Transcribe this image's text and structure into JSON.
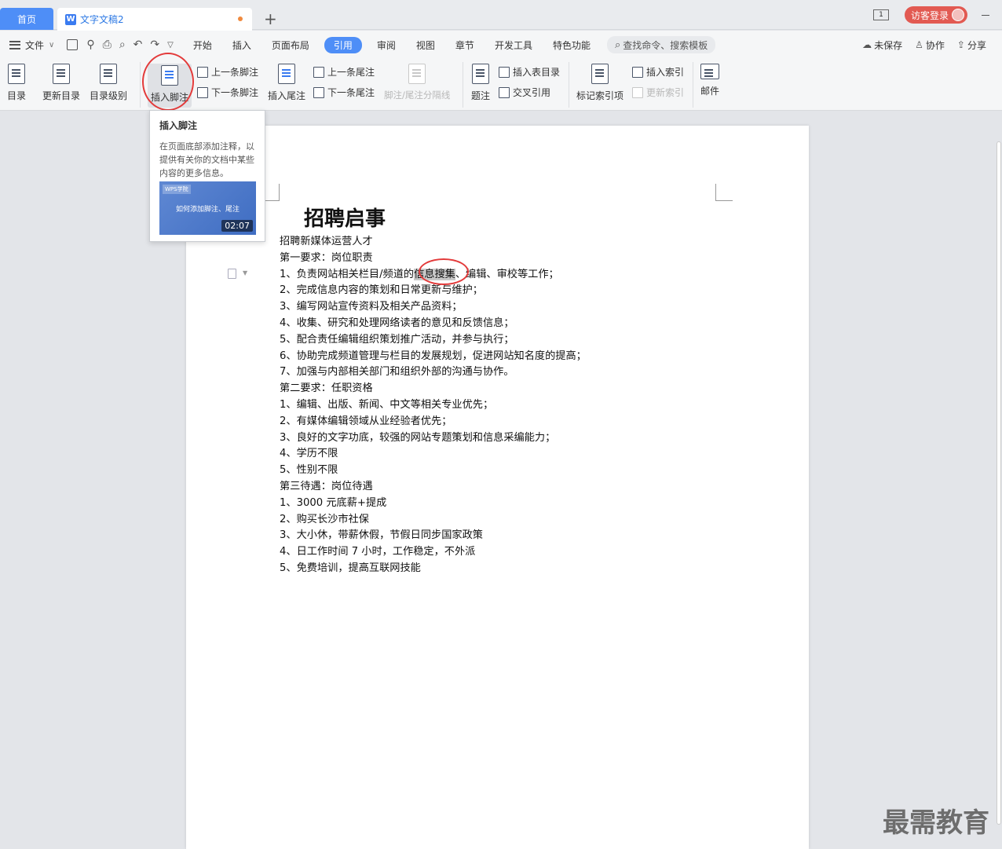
{
  "tabs": {
    "home": "首页",
    "document": "文字文稿2",
    "new": "+"
  },
  "titlebar": {
    "page_count": "1",
    "login": "访客登录"
  },
  "menu": {
    "file": "文件",
    "tabs": [
      "开始",
      "插入",
      "页面布局",
      "引用",
      "审阅",
      "视图",
      "章节",
      "开发工具",
      "特色功能"
    ],
    "active_tab": "引用",
    "search_placeholder": "查找命令、搜索模板",
    "unsaved": "未保存",
    "collaborate": "协作",
    "share": "分享"
  },
  "ribbon": {
    "toc": "目录",
    "update_toc": "更新目录",
    "toc_level": "目录级别",
    "insert_footnote": "插入脚注",
    "prev_footnote": "上一条脚注",
    "next_footnote": "下一条脚注",
    "insert_endnote": "插入尾注",
    "prev_endnote": "上一条尾注",
    "next_endnote": "下一条尾注",
    "separator_line": "脚注/尾注分隔线",
    "caption": "题注",
    "insert_table_of_figures": "插入表目录",
    "cross_reference": "交叉引用",
    "mark_index": "标记索引项",
    "insert_index": "插入索引",
    "update_index": "更新索引",
    "mail": "邮件"
  },
  "tooltip": {
    "title": "插入脚注",
    "description": "在页面底部添加注释，以提供有关你的文档中某些内容的更多信息。",
    "video_logo": "WPS学院",
    "video_title": "如何添加脚注、尾注",
    "video_duration": "02:07"
  },
  "document": {
    "title": "招聘启事",
    "line1_pre": "1、负责网站相关栏目/频道的",
    "line1_sel": "信息搜集",
    "line1_post": "、编辑、审校等工作；",
    "lines_before": [
      "招聘新媒体运营人才",
      "第一要求：岗位职责"
    ],
    "lines_after": [
      "2、完成信息内容的策划和日常更新与维护；",
      "3、编写网站宣传资料及相关产品资料；",
      "4、收集、研究和处理网络读者的意见和反馈信息；",
      "5、配合责任编辑组织策划推广活动，并参与执行；",
      "6、协助完成频道管理与栏目的发展规划，促进网站知名度的提高；",
      "7、加强与内部相关部门和组织外部的沟通与协作。",
      "第二要求：任职资格",
      "1、编辑、出版、新闻、中文等相关专业优先；",
      "2、有媒体编辑领域从业经验者优先；",
      "3、良好的文字功底，较强的网站专题策划和信息采编能力；",
      "4、学历不限",
      "5、性别不限",
      "第三待遇：岗位待遇",
      "1、3000 元底薪+提成",
      "2、购买长沙市社保",
      "3、大小休，带薪休假，节假日同步国家政策",
      "4、日工作时间 7 小时，工作稳定，不外派",
      "5、免费培训，提高互联网技能"
    ]
  },
  "watermark": "最需教育",
  "colors": {
    "accent": "#4e8ef7",
    "login": "#e25a52",
    "annotation": "#e33a3a"
  }
}
